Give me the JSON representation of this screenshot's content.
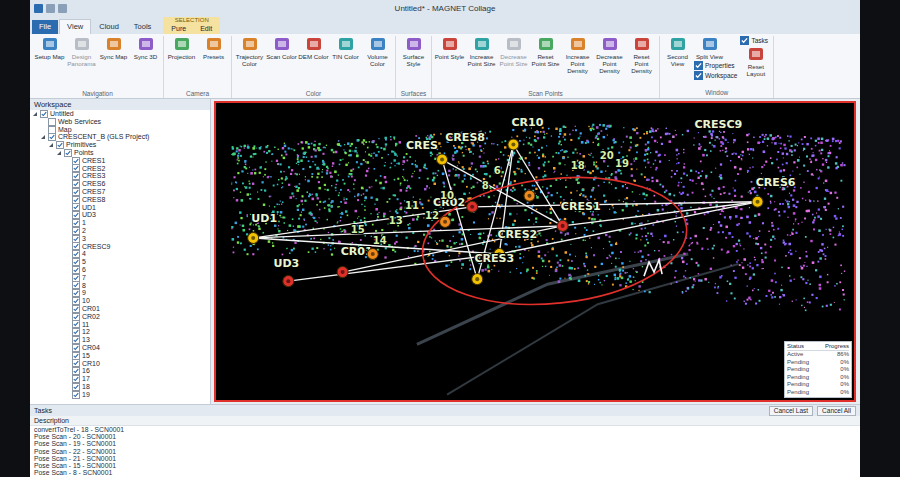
{
  "window": {
    "title": "Untitled* - MAGNET Collage"
  },
  "tabs": [
    {
      "label": "File",
      "selected": false
    },
    {
      "label": "View",
      "selected": true
    },
    {
      "label": "Cloud",
      "selected": false
    },
    {
      "label": "Tools",
      "selected": false
    }
  ],
  "contextual": {
    "label": "SELECTION",
    "tabs": [
      {
        "label": "Pure",
        "selected": false
      },
      {
        "label": "Edit",
        "selected": false
      }
    ]
  },
  "ribbon": [
    {
      "label": "Navigation",
      "buttons": [
        {
          "label": "Setup Map",
          "kind": "button",
          "disabled": false
        },
        {
          "label": "Design Panorama",
          "kind": "button",
          "disabled": true
        },
        {
          "label": "Sync Map",
          "kind": "button",
          "disabled": false
        },
        {
          "label": "Sync 3D",
          "kind": "button",
          "disabled": false
        }
      ]
    },
    {
      "label": "Camera",
      "buttons": [
        {
          "label": "Projection",
          "kind": "button",
          "disabled": false
        },
        {
          "label": "Presets",
          "kind": "button",
          "disabled": false
        }
      ]
    },
    {
      "label": "Color",
      "buttons": [
        {
          "label": "Trajectory Color",
          "kind": "button",
          "disabled": false
        },
        {
          "label": "Scan Color",
          "kind": "button",
          "disabled": false
        },
        {
          "label": "DEM Color",
          "kind": "button",
          "disabled": false
        },
        {
          "label": "TIN Color",
          "kind": "button",
          "disabled": false
        },
        {
          "label": "Volume Color",
          "kind": "button",
          "disabled": false
        }
      ]
    },
    {
      "label": "Surfaces",
      "buttons": [
        {
          "label": "Surface Style",
          "kind": "button",
          "disabled": false
        }
      ]
    },
    {
      "label": "Scan Points",
      "buttons": [
        {
          "label": "Point Style",
          "kind": "button",
          "disabled": false
        },
        {
          "label": "Increase Point Size",
          "kind": "button",
          "disabled": false
        },
        {
          "label": "Decrease Point Size",
          "kind": "button",
          "disabled": true
        },
        {
          "label": "Reset Point Size",
          "kind": "button",
          "disabled": false
        },
        {
          "label": "Increase Point Density",
          "kind": "button",
          "disabled": false
        },
        {
          "label": "Decrease Point Density",
          "kind": "button",
          "disabled": false
        },
        {
          "label": "Reset Point Density",
          "kind": "button",
          "disabled": false
        }
      ]
    },
    {
      "label": "Window",
      "buttons": [
        {
          "label": "Second View",
          "kind": "button",
          "disabled": false
        },
        {
          "label": "Split View",
          "kind": "button",
          "disabled": false
        },
        {
          "label": "Properties",
          "kind": "check",
          "checked": true
        },
        {
          "label": "Workspace",
          "kind": "check",
          "checked": true
        },
        {
          "label": "Tasks",
          "kind": "check",
          "checked": true
        },
        {
          "label": "Reset Layout",
          "kind": "button",
          "disabled": false
        }
      ]
    }
  ],
  "workspace": {
    "title": "Workspace",
    "items": [
      {
        "label": "Untitled",
        "level": 0,
        "checked": true,
        "expanded": true
      },
      {
        "label": "Web Services",
        "level": 1,
        "checked": false
      },
      {
        "label": "Map",
        "level": 1,
        "checked": false
      },
      {
        "label": "CRESCENT_B (GLS Project)",
        "level": 1,
        "checked": true,
        "expanded": true
      },
      {
        "label": "Primitives",
        "level": 2,
        "checked": true,
        "expanded": true
      },
      {
        "label": "Points",
        "level": 3,
        "checked": true,
        "expanded": true
      },
      {
        "label": "CRES1",
        "level": 4,
        "checked": true
      },
      {
        "label": "CRES2",
        "level": 4,
        "checked": true
      },
      {
        "label": "CRES3",
        "level": 4,
        "checked": true
      },
      {
        "label": "CRES6",
        "level": 4,
        "checked": true
      },
      {
        "label": "CRES7",
        "level": 4,
        "checked": true
      },
      {
        "label": "CRES8",
        "level": 4,
        "checked": true
      },
      {
        "label": "UD1",
        "level": 4,
        "checked": true
      },
      {
        "label": "UD3",
        "level": 4,
        "checked": true
      },
      {
        "label": "1",
        "level": 4,
        "checked": true
      },
      {
        "label": "2",
        "level": 4,
        "checked": true
      },
      {
        "label": "3",
        "level": 4,
        "checked": true
      },
      {
        "label": "CRESC9",
        "level": 4,
        "checked": true
      },
      {
        "label": "4",
        "level": 4,
        "checked": true
      },
      {
        "label": "5",
        "level": 4,
        "checked": true
      },
      {
        "label": "6",
        "level": 4,
        "checked": true
      },
      {
        "label": "7",
        "level": 4,
        "checked": true
      },
      {
        "label": "8",
        "level": 4,
        "checked": true
      },
      {
        "label": "9",
        "level": 4,
        "checked": true
      },
      {
        "label": "10",
        "level": 4,
        "checked": true
      },
      {
        "label": "CR01",
        "level": 4,
        "checked": true
      },
      {
        "label": "CR02",
        "level": 4,
        "checked": true
      },
      {
        "label": "11",
        "level": 4,
        "checked": true
      },
      {
        "label": "12",
        "level": 4,
        "checked": true
      },
      {
        "label": "13",
        "level": 4,
        "checked": true
      },
      {
        "label": "CR04",
        "level": 4,
        "checked": true
      },
      {
        "label": "15",
        "level": 4,
        "checked": true
      },
      {
        "label": "CR10",
        "level": 4,
        "checked": true
      },
      {
        "label": "16",
        "level": 4,
        "checked": true
      },
      {
        "label": "17",
        "level": 4,
        "checked": true
      },
      {
        "label": "18",
        "level": 4,
        "checked": true
      },
      {
        "label": "19",
        "level": 4,
        "checked": true
      }
    ]
  },
  "view": {
    "targets": [
      {
        "label": "UD1",
        "marker": true,
        "color": "#f2c200"
      },
      {
        "label": "UD3",
        "marker": true,
        "color": "#e0302b"
      },
      {
        "label": "CR01",
        "marker": true,
        "color": "#e0302b"
      },
      {
        "label": "CRES",
        "marker": false,
        "color": "#f2c200"
      },
      {
        "label": "CRES8",
        "marker": true,
        "color": "#f2c200"
      },
      {
        "label": "CR10",
        "marker": true,
        "color": "#f2c200"
      },
      {
        "label": "CRESC9",
        "marker": false,
        "color": "#f2c200"
      },
      {
        "label": "CRES6",
        "marker": true,
        "color": "#f2c200"
      },
      {
        "label": "CRES1",
        "marker": true,
        "color": "#e0302b"
      },
      {
        "label": "CRES2",
        "marker": true,
        "color": "#f2c200"
      },
      {
        "label": "CRES3",
        "marker": true,
        "color": "#f2c200"
      },
      {
        "label": "CR02",
        "marker": true,
        "color": "#e0302b"
      },
      {
        "label": "6",
        "marker": false,
        "color": "#f08a1c"
      },
      {
        "label": "18",
        "marker": false,
        "color": "#f08a1c"
      },
      {
        "label": "20",
        "marker": false,
        "color": "#f08a1c"
      },
      {
        "label": "19",
        "marker": false,
        "color": "#f08a1c"
      },
      {
        "label": "8",
        "marker": true,
        "color": "#f08a1c"
      },
      {
        "label": "10",
        "marker": false,
        "color": "#f08a1c"
      },
      {
        "label": "11",
        "marker": false,
        "color": "#f08a1c"
      },
      {
        "label": "12",
        "marker": true,
        "color": "#f08a1c"
      },
      {
        "label": "13",
        "marker": false,
        "color": "#f08a1c"
      },
      {
        "label": "14",
        "marker": true,
        "color": "#f08a1c"
      },
      {
        "label": "15",
        "marker": false,
        "color": "#f08a1c"
      }
    ],
    "links": [
      [
        "UD1",
        "CRES2"
      ],
      [
        "UD1",
        "CRES1"
      ],
      [
        "UD1",
        "CR02"
      ],
      [
        "UD3",
        "CRES2"
      ],
      [
        "CR01",
        "CRES1"
      ],
      [
        "CRES8",
        "CRES1"
      ],
      [
        "CR10",
        "CRES2"
      ],
      [
        "CR10",
        "CRES1"
      ],
      [
        "CRES6",
        "CRES1"
      ],
      [
        "CRES6",
        "CR02"
      ],
      [
        "CRES6",
        "CRES2"
      ],
      [
        "CRES3",
        "CR10"
      ],
      [
        "CRES3",
        "CRES8"
      ]
    ]
  },
  "progress": {
    "columns": [
      "Status",
      "Progress"
    ],
    "rows": [
      {
        "status": "Active",
        "progress": "86%"
      },
      {
        "status": "Pending",
        "progress": "0%"
      },
      {
        "status": "Pending",
        "progress": "0%"
      },
      {
        "status": "Pending",
        "progress": "0%"
      },
      {
        "status": "Pending",
        "progress": "0%"
      },
      {
        "status": "Pending",
        "progress": "0%"
      }
    ]
  },
  "tasks": {
    "title": "Tasks",
    "column": "Description",
    "rows": [
      "convertToTrel - 18 - SCN0001",
      "Pose Scan - 20 - SCN0001",
      "Pose Scan - 19 - SCN0001",
      "Pose Scan - 22 - SCN0001",
      "Pose Scan - 21 - SCN0001",
      "Pose Scan - 15 - SCN0001",
      "Pose Scan - 8 - SCN0001"
    ],
    "buttons": [
      "Cancel Last",
      "Cancel All"
    ]
  }
}
